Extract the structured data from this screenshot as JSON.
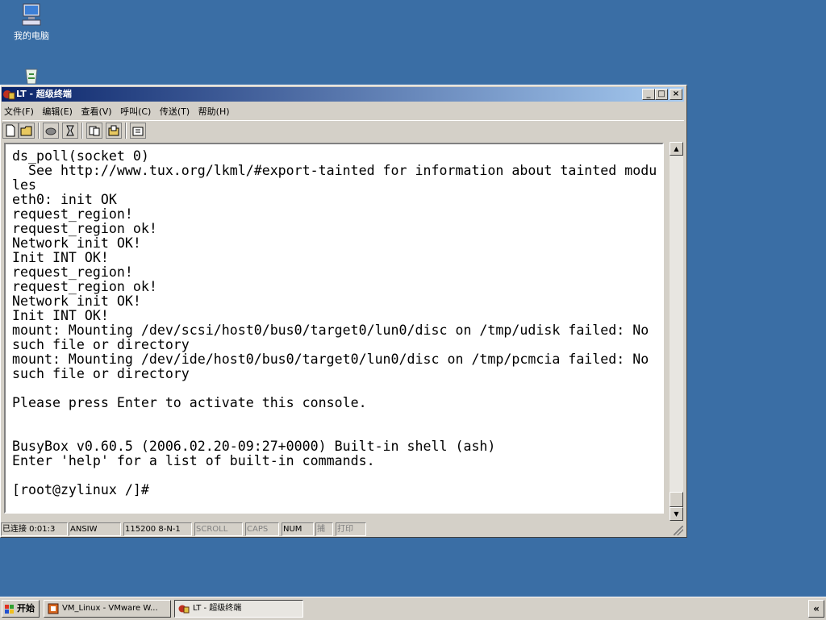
{
  "desktop": {
    "icons": [
      {
        "label": "我的电脑",
        "icon": "my-computer-icon"
      },
      {
        "label": "",
        "icon": "recycle-bin-icon"
      }
    ],
    "background_color": "#3a6ea5"
  },
  "window": {
    "title": "LT - 超级终端",
    "controls": {
      "minimize": "_",
      "maximize": "□",
      "close": "×"
    },
    "menu": [
      "文件(F)",
      "编辑(E)",
      "查看(V)",
      "呼叫(C)",
      "传送(T)",
      "帮助(H)"
    ],
    "toolbar_icons": [
      "new-icon",
      "open-icon",
      "disconnect-icon",
      "dial-icon",
      "send-icon",
      "receive-icon",
      "properties-icon"
    ],
    "terminal_lines": [
      "ds_poll(socket 0)",
      "  See http://www.tux.org/lkml/#export-tainted for information about tainted modu",
      "les",
      "eth0: init OK",
      "request_region!",
      "request_region ok!",
      "Network init OK!",
      "Init INT OK!",
      "request_region!",
      "request_region ok!",
      "Network init OK!",
      "Init INT OK!",
      "mount: Mounting /dev/scsi/host0/bus0/target0/lun0/disc on /tmp/udisk failed: No",
      "such file or directory",
      "mount: Mounting /dev/ide/host0/bus0/target0/lun0/disc on /tmp/pcmcia failed: No",
      "such file or directory",
      "",
      "Please press Enter to activate this console.",
      "",
      "",
      "BusyBox v0.60.5 (2006.02.20-09:27+0000) Built-in shell (ash)",
      "Enter 'help' for a list of built-in commands.",
      "",
      "[root@zylinux /]#"
    ],
    "scrollbar": {
      "up": "▲",
      "down": "▼"
    },
    "status": {
      "connected": "已连接 0:01:3",
      "emulation": "ANSIW",
      "port_settings": "115200 8-N-1",
      "scroll": "SCROLL",
      "caps": "CAPS",
      "num": "NUM",
      "capture": "捕",
      "print": "打印"
    }
  },
  "taskbar": {
    "start_label": "开始",
    "tasks": [
      {
        "label": "VM_Linux - VMware W...",
        "active": false,
        "icon": "vmware-icon"
      },
      {
        "label": "LT - 超级终端",
        "active": true,
        "icon": "hyperterminal-icon"
      }
    ],
    "tray_toggle": "«"
  }
}
